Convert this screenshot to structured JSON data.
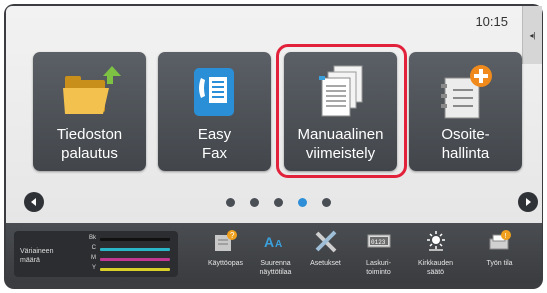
{
  "status": {
    "time": "10:15",
    "side_tab_glyph": "◂|"
  },
  "tiles": [
    {
      "icon": "folder-download-icon",
      "line1": "Tiedoston",
      "line2": "palautus"
    },
    {
      "icon": "fax-icon",
      "line1": "Easy",
      "line2": "Fax"
    },
    {
      "icon": "manual-finishing-icon",
      "line1": "Manuaalinen",
      "line2": "viimeistely",
      "highlighted": true
    },
    {
      "icon": "address-book-add-icon",
      "line1": "Osoite-",
      "line2": "hallinta"
    }
  ],
  "pager": {
    "page_count": 5,
    "active_page": 4,
    "prev_icon": "chevron-left-icon",
    "next_icon": "chevron-right-icon"
  },
  "toner": {
    "title_line1": "Väriaineen",
    "title_line2": "määrä",
    "rows": [
      {
        "label": "Bk",
        "color": "#111111"
      },
      {
        "label": "C",
        "color": "#2bb6c8"
      },
      {
        "label": "M",
        "color": "#c2378f"
      },
      {
        "label": "Y",
        "color": "#d9d02a"
      }
    ]
  },
  "shortcuts": [
    {
      "icon": "help-guide-icon",
      "line1": "Käyttöopas",
      "line2": ""
    },
    {
      "icon": "enlarge-display-icon",
      "line1": "Suurenna",
      "line2": "näyttötilaa"
    },
    {
      "icon": "settings-tools-icon",
      "line1": "Asetukset",
      "line2": ""
    },
    {
      "icon": "counter-icon",
      "line1": "Laskuri-",
      "line2": "toiminto"
    },
    {
      "icon": "brightness-icon",
      "line1": "Kirkkauden",
      "line2": "säätö"
    },
    {
      "icon": "job-status-icon",
      "line1": "Työn tila",
      "line2": ""
    }
  ],
  "colors": {
    "highlight": "#e2213a",
    "active_dot": "#2e8fd8",
    "inactive_dot": "#4a4f56"
  }
}
